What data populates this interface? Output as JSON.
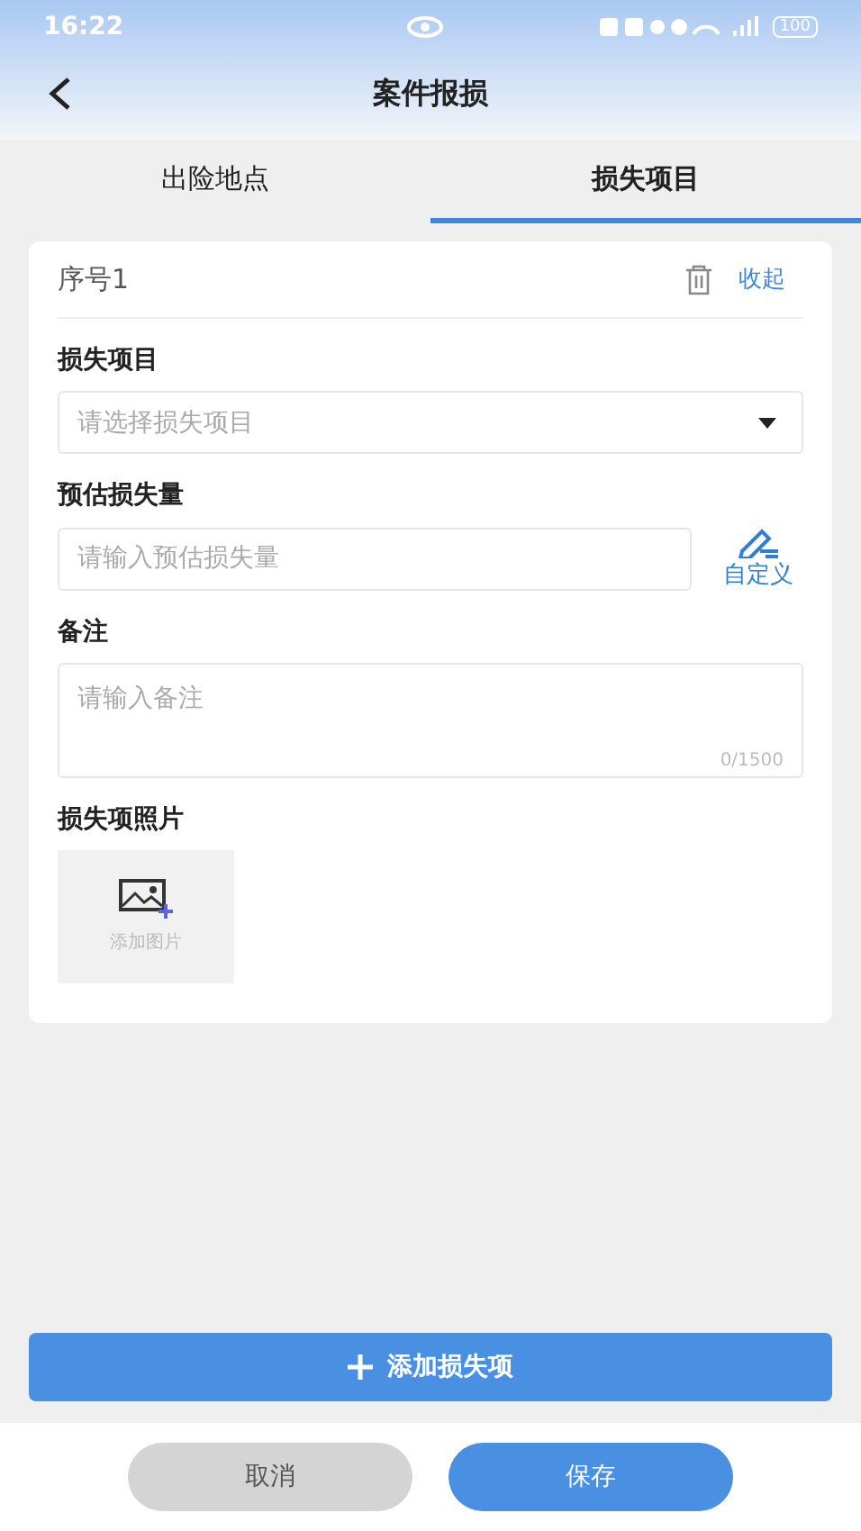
{
  "status_bar": {
    "time": "16:22",
    "battery": "100"
  },
  "header": {
    "title": "案件报损"
  },
  "tabs": [
    {
      "label": "出险地点",
      "selected": false
    },
    {
      "label": "损失项目",
      "selected": true
    }
  ],
  "card": {
    "title": "序号1",
    "collapse": "收起",
    "fields": [
      {
        "kind": "select",
        "label": "损失项目",
        "placeholder": "请选择损失项目"
      },
      {
        "kind": "input",
        "label": "预估损失量",
        "placeholder": "请输入预估损失量",
        "action": "自定义"
      },
      {
        "kind": "textarea",
        "label": "备注",
        "placeholder": "请输入备注",
        "counter": "0/1500"
      },
      {
        "kind": "photo",
        "label": "损失项照片",
        "button": "添加图片"
      }
    ]
  },
  "add_button": "添加损失项",
  "footer": [
    {
      "kind": "secondary",
      "label": "取消"
    },
    {
      "kind": "primary",
      "label": "保存"
    }
  ]
}
